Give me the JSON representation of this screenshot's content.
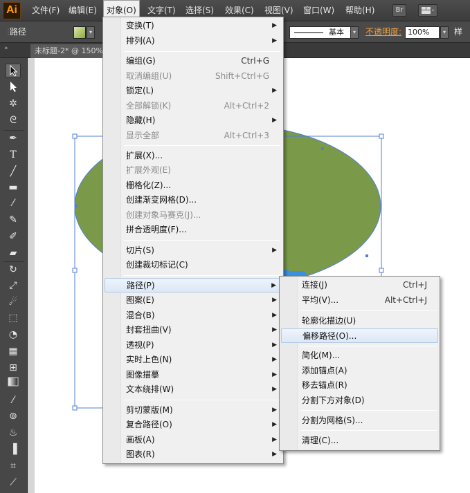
{
  "app": {
    "logo": "Ai"
  },
  "menubar": {
    "items": [
      "文件(F)",
      "编辑(E)",
      "对象(O)",
      "文字(T)",
      "选择(S)",
      "效果(C)",
      "视图(V)",
      "窗口(W)",
      "帮助(H)"
    ],
    "bridge_label": "Br"
  },
  "control_bar": {
    "selection_type": "路径",
    "stroke_style": "基本",
    "opacity_label": "不透明度:",
    "opacity_value": "100%",
    "style_label": "样式"
  },
  "document_tab": {
    "title": "未标题-2* @ 150%"
  },
  "object_menu": {
    "items": [
      {
        "label": "变换(T)",
        "shortcut": "",
        "submenu": true,
        "enabled": true
      },
      {
        "label": "排列(A)",
        "shortcut": "",
        "submenu": true,
        "enabled": true
      },
      {
        "label": "编组(G)",
        "shortcut": "Ctrl+G",
        "submenu": false,
        "enabled": true
      },
      {
        "label": "取消编组(U)",
        "shortcut": "Shift+Ctrl+G",
        "submenu": false,
        "enabled": false
      },
      {
        "label": "锁定(L)",
        "shortcut": "",
        "submenu": true,
        "enabled": true
      },
      {
        "label": "全部解锁(K)",
        "shortcut": "Alt+Ctrl+2",
        "submenu": false,
        "enabled": false
      },
      {
        "label": "隐藏(H)",
        "shortcut": "",
        "submenu": true,
        "enabled": true
      },
      {
        "label": "显示全部",
        "shortcut": "Alt+Ctrl+3",
        "submenu": false,
        "enabled": false
      },
      {
        "label": "扩展(X)...",
        "shortcut": "",
        "submenu": false,
        "enabled": true
      },
      {
        "label": "扩展外观(E)",
        "shortcut": "",
        "submenu": false,
        "enabled": false
      },
      {
        "label": "栅格化(Z)...",
        "shortcut": "",
        "submenu": false,
        "enabled": true
      },
      {
        "label": "创建渐变网格(D)...",
        "shortcut": "",
        "submenu": false,
        "enabled": true
      },
      {
        "label": "创建对象马赛克(J)...",
        "shortcut": "",
        "submenu": false,
        "enabled": false
      },
      {
        "label": "拼合透明度(F)...",
        "shortcut": "",
        "submenu": false,
        "enabled": true
      },
      {
        "label": "切片(S)",
        "shortcut": "",
        "submenu": true,
        "enabled": true
      },
      {
        "label": "创建裁切标记(C)",
        "shortcut": "",
        "submenu": false,
        "enabled": true
      },
      {
        "label": "路径(P)",
        "shortcut": "",
        "submenu": true,
        "enabled": true
      },
      {
        "label": "图案(E)",
        "shortcut": "",
        "submenu": true,
        "enabled": true
      },
      {
        "label": "混合(B)",
        "shortcut": "",
        "submenu": true,
        "enabled": true
      },
      {
        "label": "封套扭曲(V)",
        "shortcut": "",
        "submenu": true,
        "enabled": true
      },
      {
        "label": "透视(P)",
        "shortcut": "",
        "submenu": true,
        "enabled": true
      },
      {
        "label": "实时上色(N)",
        "shortcut": "",
        "submenu": true,
        "enabled": true
      },
      {
        "label": "图像描摹",
        "shortcut": "",
        "submenu": true,
        "enabled": true
      },
      {
        "label": "文本绕排(W)",
        "shortcut": "",
        "submenu": true,
        "enabled": true
      },
      {
        "label": "剪切蒙版(M)",
        "shortcut": "",
        "submenu": true,
        "enabled": true
      },
      {
        "label": "复合路径(O)",
        "shortcut": "",
        "submenu": true,
        "enabled": true
      },
      {
        "label": "画板(A)",
        "shortcut": "",
        "submenu": true,
        "enabled": true
      },
      {
        "label": "图表(R)",
        "shortcut": "",
        "submenu": true,
        "enabled": true
      }
    ]
  },
  "path_submenu": {
    "items": [
      {
        "label": "连接(J)",
        "shortcut": "Ctrl+J"
      },
      {
        "label": "平均(V)...",
        "shortcut": "Alt+Ctrl+J"
      },
      {
        "label": "轮廓化描边(U)",
        "shortcut": ""
      },
      {
        "label": "偏移路径(O)...",
        "shortcut": ""
      },
      {
        "label": "简化(M)...",
        "shortcut": ""
      },
      {
        "label": "添加锚点(A)",
        "shortcut": ""
      },
      {
        "label": "移去锚点(R)",
        "shortcut": ""
      },
      {
        "label": "分割下方对象(D)",
        "shortcut": ""
      },
      {
        "label": "分割为网格(S)...",
        "shortcut": ""
      },
      {
        "label": "清理(C)...",
        "shortcut": ""
      }
    ]
  },
  "tools": [
    "selection-tool",
    "direct-selection-tool",
    "magic-wand-tool",
    "lasso-tool",
    "pen-tool",
    "type-tool",
    "line-tool",
    "rectangle-tool",
    "paintbrush-tool",
    "pencil-tool",
    "blob-brush-tool",
    "eraser-tool",
    "rotate-tool",
    "scale-tool",
    "warp-tool",
    "free-transform-tool",
    "shape-builder-tool",
    "perspective-grid-tool",
    "mesh-tool",
    "gradient-tool",
    "eyedropper-tool",
    "blend-tool",
    "symbol-sprayer-tool",
    "column-graph-tool",
    "artboard-tool",
    "slice-tool"
  ],
  "colors": {
    "ellipse_fill": "#7a9a4a",
    "selection_blue": "#4f7fd6",
    "menu_highlight": "#dce8f6",
    "inner_shape_blue": "#3b8fe0"
  }
}
